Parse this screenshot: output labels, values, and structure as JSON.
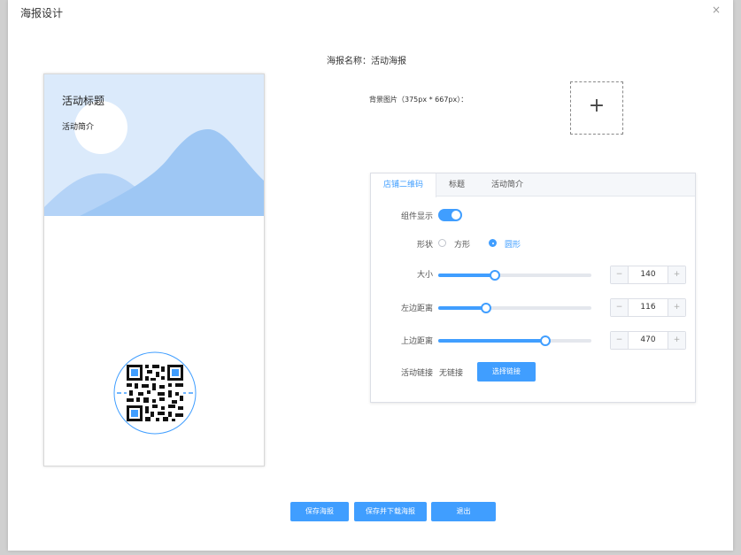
{
  "dialog": {
    "title": "海报设计",
    "close_glyph": "×",
    "close_icon": "close-icon"
  },
  "poster_name": "海报名称：活动海报",
  "preview": {
    "title": "活动标题",
    "subtitle": "活动简介",
    "colors": {
      "sky": "#dbeafb",
      "sun": "#ffffff",
      "mountain_back": "#b4d3f7",
      "mountain_front": "#9ec7f4",
      "qr_accent": "#409eff"
    }
  },
  "background": {
    "label": "背景图片（375px * 667px）：",
    "upload_glyph": "+",
    "upload_icon": "plus-icon"
  },
  "tabs": [
    {
      "label": "店铺二维码",
      "active": true
    },
    {
      "label": "标题",
      "active": false
    },
    {
      "label": "活动简介",
      "active": false
    }
  ],
  "settings": {
    "display_label": "组件显示",
    "display_on": true,
    "shape_label": "形状",
    "shape_options": [
      {
        "label": "方形",
        "selected": false
      },
      {
        "label": "圆形",
        "selected": true
      }
    ],
    "size": {
      "label": "大小",
      "value": "140",
      "fraction": 0.37
    },
    "left": {
      "label": "左边距离",
      "value": "116",
      "fraction": 0.31
    },
    "top": {
      "label": "上边距离",
      "value": "470",
      "fraction": 0.7
    },
    "stepper_dec": "−",
    "stepper_inc": "+",
    "link_label": "活动链接",
    "link_value": "无链接",
    "link_button": "选择链接"
  },
  "footer": {
    "save": "保存海报",
    "save_download": "保存并下载海报",
    "exit": "退出"
  },
  "accent_color": "#409eff"
}
